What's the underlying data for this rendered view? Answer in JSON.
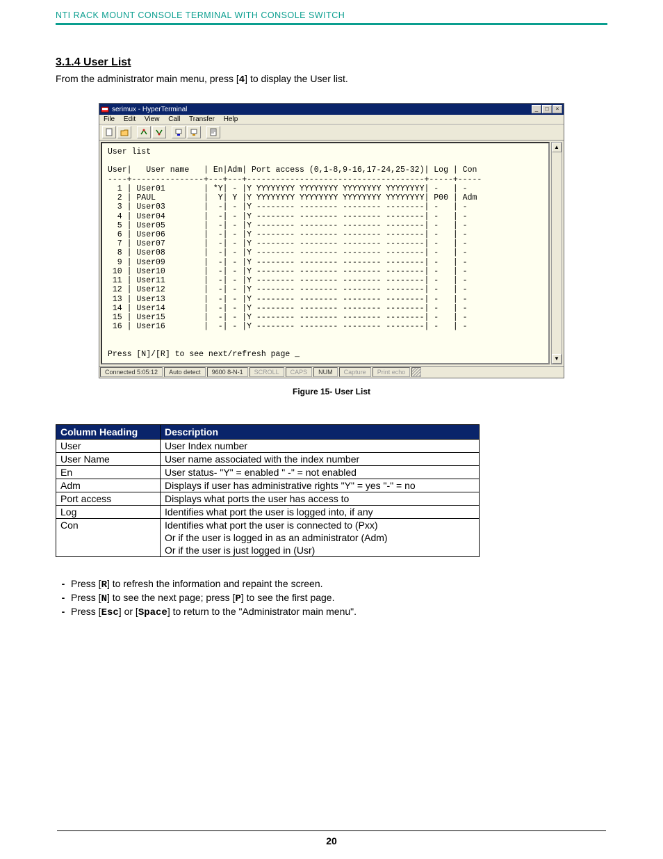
{
  "header": "NTI RACK MOUNT CONSOLE TERMINAL WITH CONSOLE SWITCH",
  "section_heading": "3.1.4 User List",
  "intro": {
    "pre": " From the administrator main menu,  press [",
    "key": "4",
    "post": "] to display the User list."
  },
  "hyperterminal": {
    "title": "serimux - HyperTerminal",
    "menus": [
      "File",
      "Edit",
      "View",
      "Call",
      "Transfer",
      "Help"
    ],
    "window_controls": {
      "min": "_",
      "max": "□",
      "close": "×"
    },
    "status": {
      "connected": "Connected 5:05:12",
      "detect": "Auto detect",
      "params": "9600 8-N-1",
      "scroll": "SCROLL",
      "caps": "CAPS",
      "num": "NUM",
      "capture": "Capture",
      "echo": "Print echo"
    }
  },
  "terminal": {
    "title_line": "User list",
    "header_line": "User|   User name   | En|Adm| Port access (0,1-8,9-16,17-24,25-32)| Log | Con",
    "rows": [
      {
        "idx": " 1",
        "name": "User01",
        "en": "*Y",
        "adm": "-",
        "ports": "Y YYYYYYYY YYYYYYYY YYYYYYYY YYYYYYYY",
        "log": "-",
        "con": "-"
      },
      {
        "idx": " 2",
        "name": "PAUL",
        "en": " Y",
        "adm": "Y",
        "ports": "Y YYYYYYYY YYYYYYYY YYYYYYYY YYYYYYYY",
        "log": "P00",
        "con": "Adm"
      },
      {
        "idx": " 3",
        "name": "User03",
        "en": " -",
        "adm": "-",
        "ports": "Y -------- -------- -------- --------",
        "log": "-",
        "con": "-"
      },
      {
        "idx": " 4",
        "name": "User04",
        "en": " -",
        "adm": "-",
        "ports": "Y -------- -------- -------- --------",
        "log": "-",
        "con": "-"
      },
      {
        "idx": " 5",
        "name": "User05",
        "en": " -",
        "adm": "-",
        "ports": "Y -------- -------- -------- --------",
        "log": "-",
        "con": "-"
      },
      {
        "idx": " 6",
        "name": "User06",
        "en": " -",
        "adm": "-",
        "ports": "Y -------- -------- -------- --------",
        "log": "-",
        "con": "-"
      },
      {
        "idx": " 7",
        "name": "User07",
        "en": " -",
        "adm": "-",
        "ports": "Y -------- -------- -------- --------",
        "log": "-",
        "con": "-"
      },
      {
        "idx": " 8",
        "name": "User08",
        "en": " -",
        "adm": "-",
        "ports": "Y -------- -------- -------- --------",
        "log": "-",
        "con": "-"
      },
      {
        "idx": " 9",
        "name": "User09",
        "en": " -",
        "adm": "-",
        "ports": "Y -------- -------- -------- --------",
        "log": "-",
        "con": "-"
      },
      {
        "idx": "10",
        "name": "User10",
        "en": " -",
        "adm": "-",
        "ports": "Y -------- -------- -------- --------",
        "log": "-",
        "con": "-"
      },
      {
        "idx": "11",
        "name": "User11",
        "en": " -",
        "adm": "-",
        "ports": "Y -------- -------- -------- --------",
        "log": "-",
        "con": "-"
      },
      {
        "idx": "12",
        "name": "User12",
        "en": " -",
        "adm": "-",
        "ports": "Y -------- -------- -------- --------",
        "log": "-",
        "con": "-"
      },
      {
        "idx": "13",
        "name": "User13",
        "en": " -",
        "adm": "-",
        "ports": "Y -------- -------- -------- --------",
        "log": "-",
        "con": "-"
      },
      {
        "idx": "14",
        "name": "User14",
        "en": " -",
        "adm": "-",
        "ports": "Y -------- -------- -------- --------",
        "log": "-",
        "con": "-"
      },
      {
        "idx": "15",
        "name": "User15",
        "en": " -",
        "adm": "-",
        "ports": "Y -------- -------- -------- --------",
        "log": "-",
        "con": "-"
      },
      {
        "idx": "16",
        "name": "User16",
        "en": " -",
        "adm": "-",
        "ports": "Y -------- -------- -------- --------",
        "log": "-",
        "con": "-"
      }
    ],
    "footer_line": "Press [N]/[R] to see next/refresh page _"
  },
  "figure_caption": "Figure 15- User List",
  "desc_table": {
    "headers": [
      "Column Heading",
      "Description"
    ],
    "rows": [
      [
        "User",
        "User Index number"
      ],
      [
        "User Name",
        "User name associated with the index number"
      ],
      [
        "En",
        "User status- \"Y\" = enabled  \" -\" = not enabled"
      ],
      [
        "Adm",
        "Displays if user has administrative rights   \"Y\" = yes   \"-\" = no"
      ],
      [
        "Port access",
        "Displays what ports the user has access to"
      ],
      [
        "Log",
        "Identifies what port the user is logged into, if any"
      ],
      [
        "Con",
        "Identifies what port the user is connected to (Pxx)\nOr if the user is logged in as an administrator (Adm)\nOr if the user is just logged in (Usr)"
      ]
    ]
  },
  "instructions": [
    {
      "parts": [
        "Press [",
        "R",
        "] to refresh the information and repaint the screen."
      ]
    },
    {
      "parts": [
        "Press [",
        "N",
        "] to see the next page; press [",
        "P",
        "] to see the first page."
      ]
    },
    {
      "parts": [
        "Press [",
        "Esc",
        "] or [",
        "Space",
        "] to return to the \"Administrator main menu\"."
      ]
    }
  ],
  "page_number": "20"
}
